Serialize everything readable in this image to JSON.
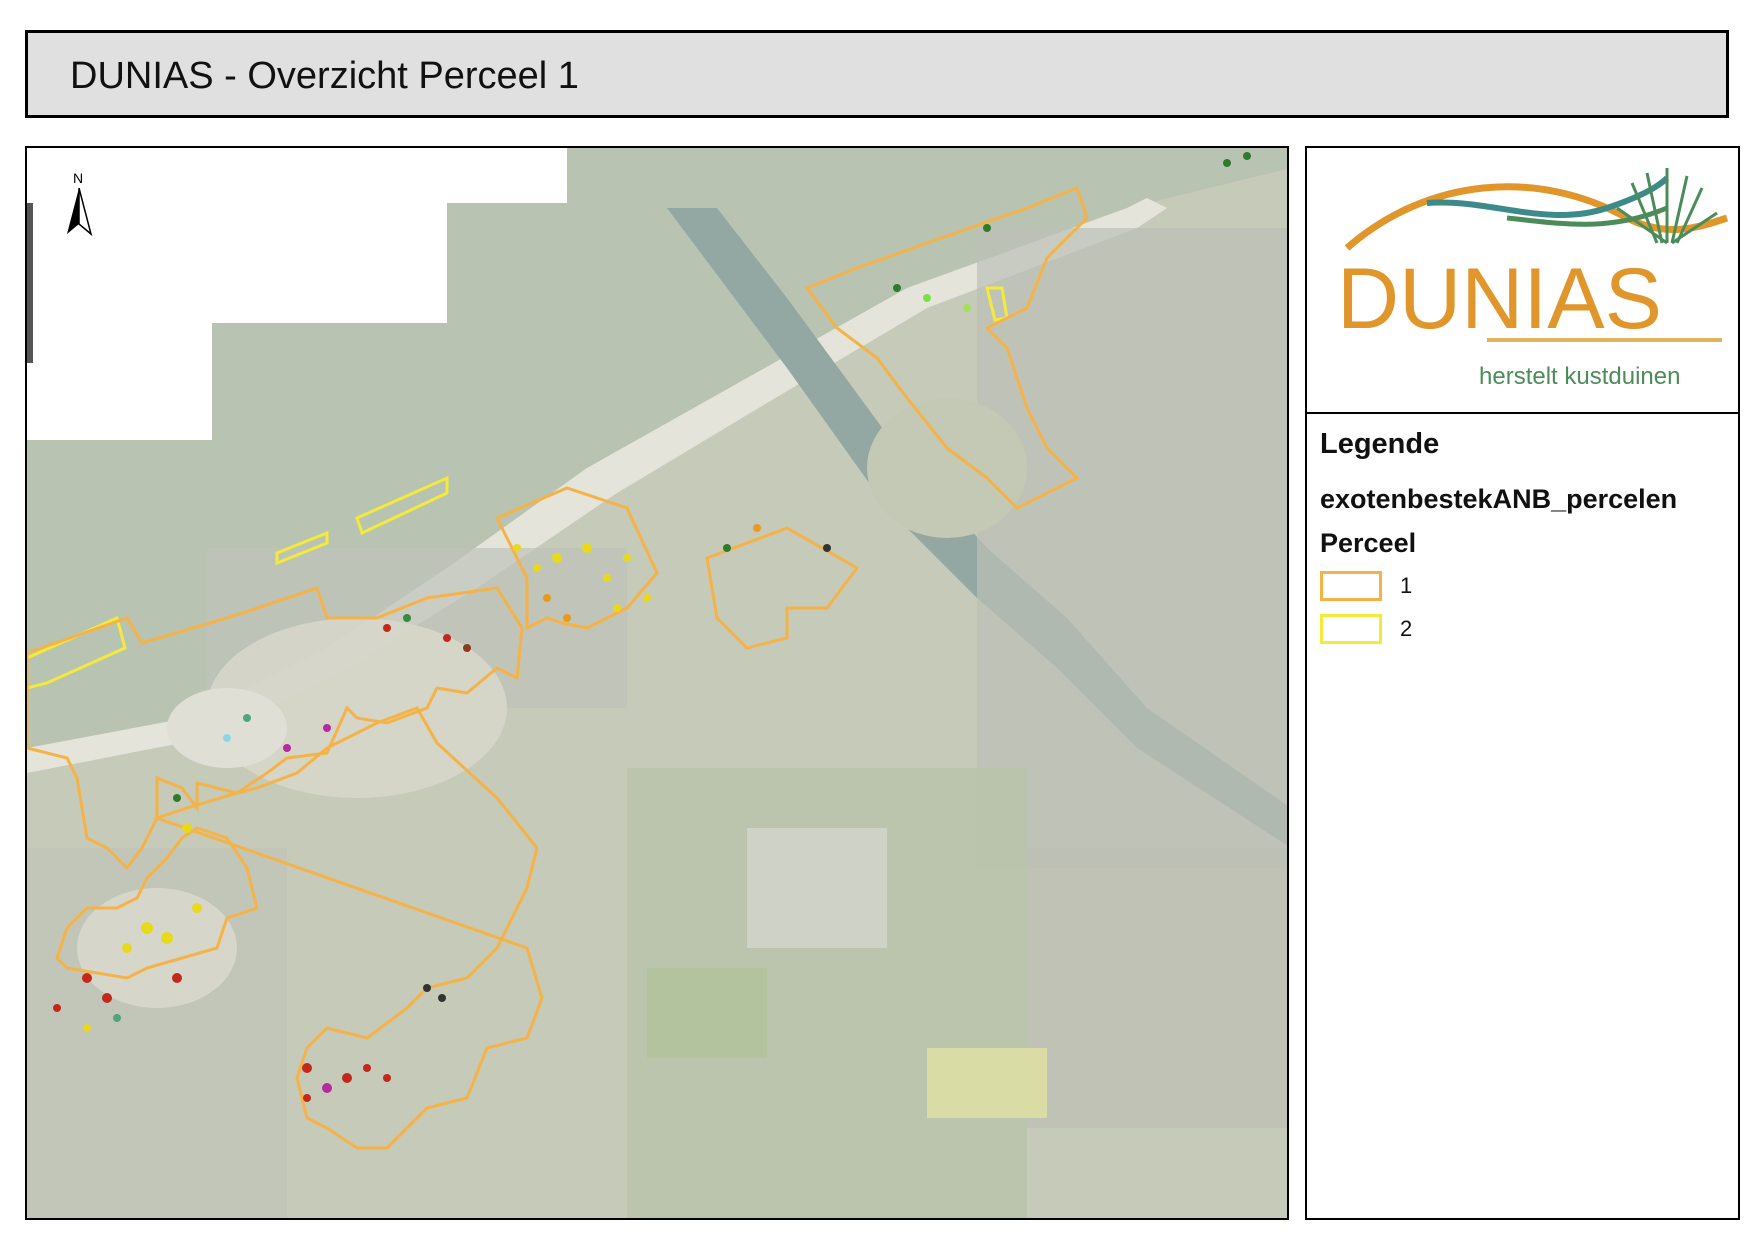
{
  "title": "DUNIAS - Overzicht Perceel 1",
  "map": {
    "north_label": "N",
    "colors": {
      "perceel_1": "#f5b347",
      "perceel_2": "#f3ea3a",
      "sea": "#b9c4b3",
      "beach": "#e6e5dc",
      "land": "#c7ccbb",
      "water_channel": "#8ea5a0"
    }
  },
  "logo": {
    "name": "DUNIAS",
    "tagline": "herstelt kustduinen",
    "colors": {
      "gold": "#e0962a",
      "teal": "#3c8a8a",
      "green": "#4c8c5a"
    }
  },
  "legend": {
    "title": "Legende",
    "layer": "exotenbestekANB_percelen",
    "field": "Perceel",
    "items": [
      {
        "label": "1",
        "color": "#f5b347"
      },
      {
        "label": "2",
        "color": "#f3ea3a"
      }
    ]
  }
}
